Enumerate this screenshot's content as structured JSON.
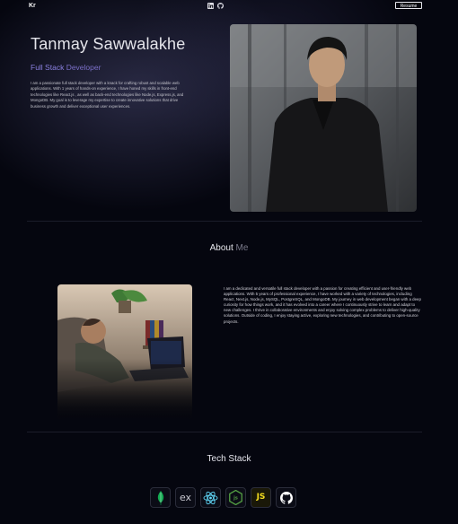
{
  "nav": {
    "logo": "Kr",
    "social": [
      {
        "icon": "linkedin-icon"
      },
      {
        "icon": "github-icon"
      }
    ],
    "resume_label": "Resume"
  },
  "hero": {
    "name": "Tanmay Sawwalakhe",
    "role_part1": "Full Stack",
    "role_part2": " Developer",
    "description": "I am a passionate full stack developer with a knack for crafting robust and scalable web applications. With 1 years of hands-on experience, I have honed my skills in front-end technologies like React.js , as well as back-end technologies like Node.js, Express.js, and MongoDB. My goal is to leverage my expertise to create innovative solutions that drive business growth and deliver exceptional user experiences."
  },
  "about": {
    "title_part1": "About",
    "title_part2": " Me",
    "description": "I am a dedicated and versatile full stack developer with a passion for creating efficient and user-friendly web applications. With 5 years of professional experience, I have worked with a variety of technologies, including React, Next.js, Node.js, MySQL, PostgreSQL, and MongoDB. My journey in web development began with a deep curiosity for how things work, and it has evolved into a career where I continuously strive to learn and adapt to new challenges. I thrive in collaborative environments and enjoy solving complex problems to deliver high-quality solutions. Outside of coding, I enjoy staying active, exploring new technologies, and contributing to open-source projects."
  },
  "tech": {
    "title": "Tech Stack",
    "items": [
      {
        "icon": "mongodb-icon",
        "color": "#13aa52"
      },
      {
        "icon": "express-icon",
        "label": "ex",
        "color": "#c8c8d0"
      },
      {
        "icon": "react-icon",
        "color": "#61dafb"
      },
      {
        "icon": "nodejs-icon",
        "color": "#539e43"
      },
      {
        "icon": "javascript-icon",
        "label": "JS",
        "color": "#f7df1e"
      },
      {
        "icon": "github-icon",
        "color": "#ffffff"
      }
    ]
  },
  "colors": {
    "background": "#05060f",
    "accent": "#8a80e0",
    "divider": "#1b1d2a"
  }
}
